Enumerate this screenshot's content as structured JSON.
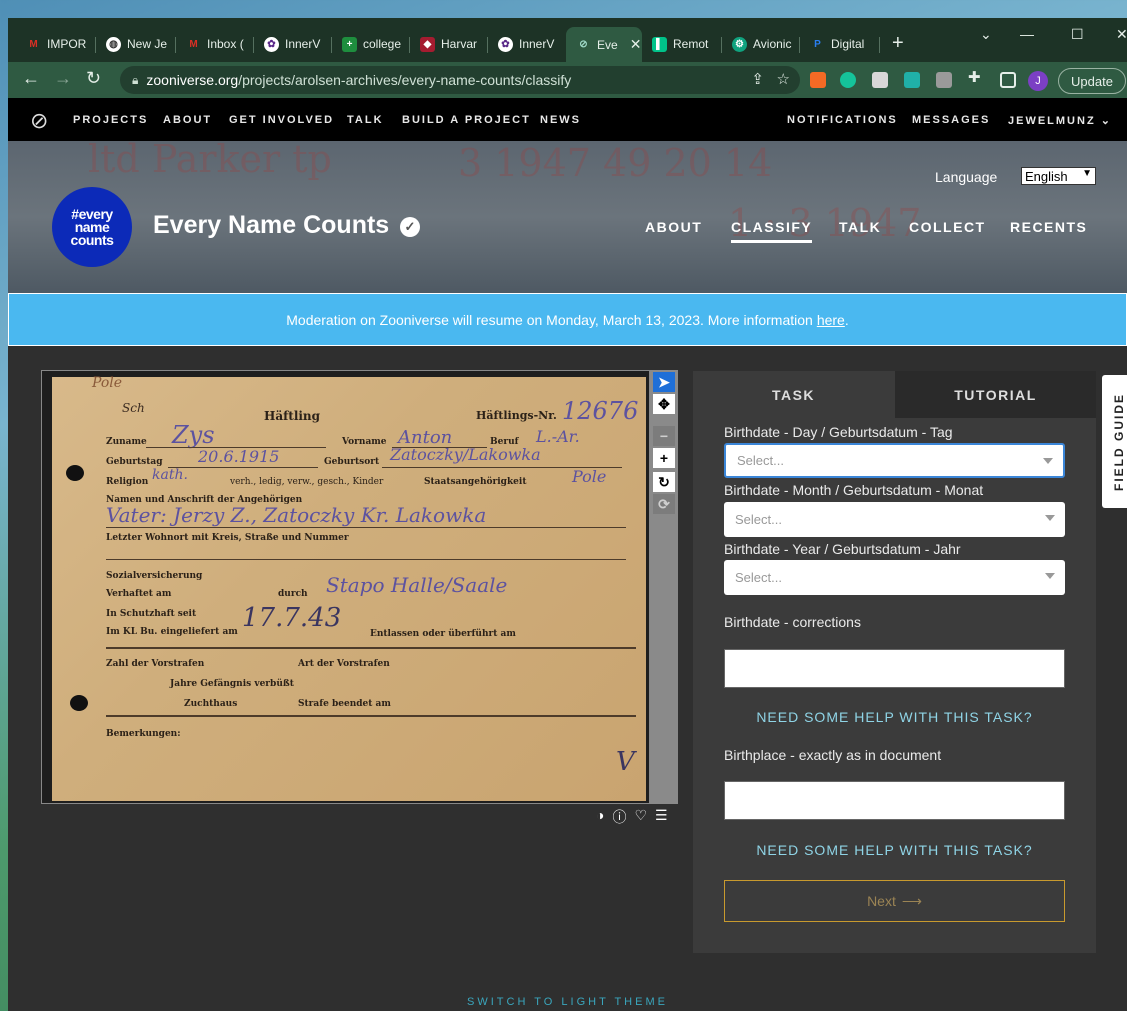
{
  "browser": {
    "tabs": [
      {
        "label": "IMPOR",
        "icon": "gmail-icon",
        "color": "#d93025"
      },
      {
        "label": "New Je",
        "icon": "globe-icon",
        "color": "#ffffff"
      },
      {
        "label": "Inbox (",
        "icon": "gmail-icon",
        "color": "#d93025"
      },
      {
        "label": "InnerV",
        "icon": "innerv-icon",
        "color": "#ffffff"
      },
      {
        "label": "college",
        "icon": "sheets-icon",
        "color": "#1e8e3e"
      },
      {
        "label": "Harvar",
        "icon": "harvard-icon",
        "color": "#a51c30"
      },
      {
        "label": "InnerV",
        "icon": "innerv-icon",
        "color": "#ffffff"
      },
      {
        "label": "Eve",
        "icon": "zooniverse-icon",
        "color": "#2f5a42"
      },
      {
        "label": "Remot",
        "icon": "remote-icon",
        "color": "#00c389"
      },
      {
        "label": "Avionic",
        "icon": "openai-icon",
        "color": "#10a37f"
      },
      {
        "label": "Digital",
        "icon": "paypal-icon",
        "color": "#003087"
      }
    ],
    "url_host": "zooniverse.org",
    "url_path": "/projects/arolsen-archives/every-name-counts/classify",
    "update_label": "Update",
    "avatar_letter": "J"
  },
  "znav": {
    "left": [
      "PROJECTS",
      "ABOUT",
      "GET INVOLVED",
      "TALK",
      "BUILD A PROJECT",
      "NEWS"
    ],
    "right": [
      "NOTIFICATIONS",
      "MESSAGES",
      "JEWELMUNZ"
    ]
  },
  "project": {
    "badge_lines": [
      "#every",
      "name",
      "counts"
    ],
    "title": "Every Name Counts",
    "language_label": "Language",
    "language_value": "English",
    "nav": [
      "ABOUT",
      "CLASSIFY",
      "TALK",
      "COLLECT",
      "RECENTS"
    ],
    "active_nav": "CLASSIFY"
  },
  "banner": {
    "text": "Moderation on Zooniverse will resume on Monday, March 13, 2023. More information",
    "link": "here",
    "tail": "."
  },
  "card": {
    "labels": {
      "haeftling": "Häftling",
      "nr": "Häftlings-Nr.",
      "zuname": "Zuname",
      "vorname": "Vorname",
      "beruf": "Beruf",
      "geburtstag": "Geburtstag",
      "geburtsort": "Geburtsort",
      "religion": "Religion",
      "familienstand": "verh., ledig, verw., gesch., Kinder",
      "staat": "Staatsangehörigkeit",
      "angehoerige": "Namen und Anschrift der Angehörigen",
      "wohnort": "Letzter Wohnort mit Kreis, Straße und Nummer",
      "sozial": "Sozialversicherung",
      "verhaftet": "Verhaftet am",
      "durch": "durch",
      "schutzhaft": "In Schutzhaft seit",
      "eingeliefert": "Im KL Bu. eingeliefert am",
      "entlassen": "Entlassen oder überführt am",
      "vorstrafen": "Zahl der Vorstrafen",
      "art": "Art der Vorstrafen",
      "gefaengnis": "Jahre Gefängnis verbüßt",
      "zuchthaus": "Zuchthaus",
      "strafe": "Strafe beendet am",
      "bemerkungen": "Bemerkungen:"
    },
    "handwriting": {
      "corner": "Pole",
      "sch": "Sch",
      "number": "12676",
      "surname": "Zys",
      "firstname": "Anton",
      "job": "L.-Ar.",
      "birthdate": "20.6.1915",
      "birthplace": "Zatoczky/Lakowka",
      "religion": "kath.",
      "nation": "Pole",
      "relatives": "Vater: Jerzy Z., Zatoczky Kr. Lakowka",
      "arrest_by": "Stapo Halle/Saale",
      "admitted": "17.7.43",
      "check": "V"
    }
  },
  "tabs": {
    "task": "TASK",
    "tutorial": "TUTORIAL"
  },
  "task": {
    "day_label": "Birthdate - Day / Geburtsdatum - Tag",
    "month_label": "Birthdate - Month / Geburtsdatum - Monat",
    "year_label": "Birthdate - Year / Geburtsdatum - Jahr",
    "select_placeholder": "Select...",
    "corrections_label": "Birthdate - corrections",
    "help_text": "NEED SOME HELP WITH THIS TASK?",
    "birthplace_label": "Birthplace - exactly as in document",
    "next_label": "Next"
  },
  "field_guide": "FIELD GUIDE",
  "theme_link": "SWITCH TO LIGHT THEME"
}
